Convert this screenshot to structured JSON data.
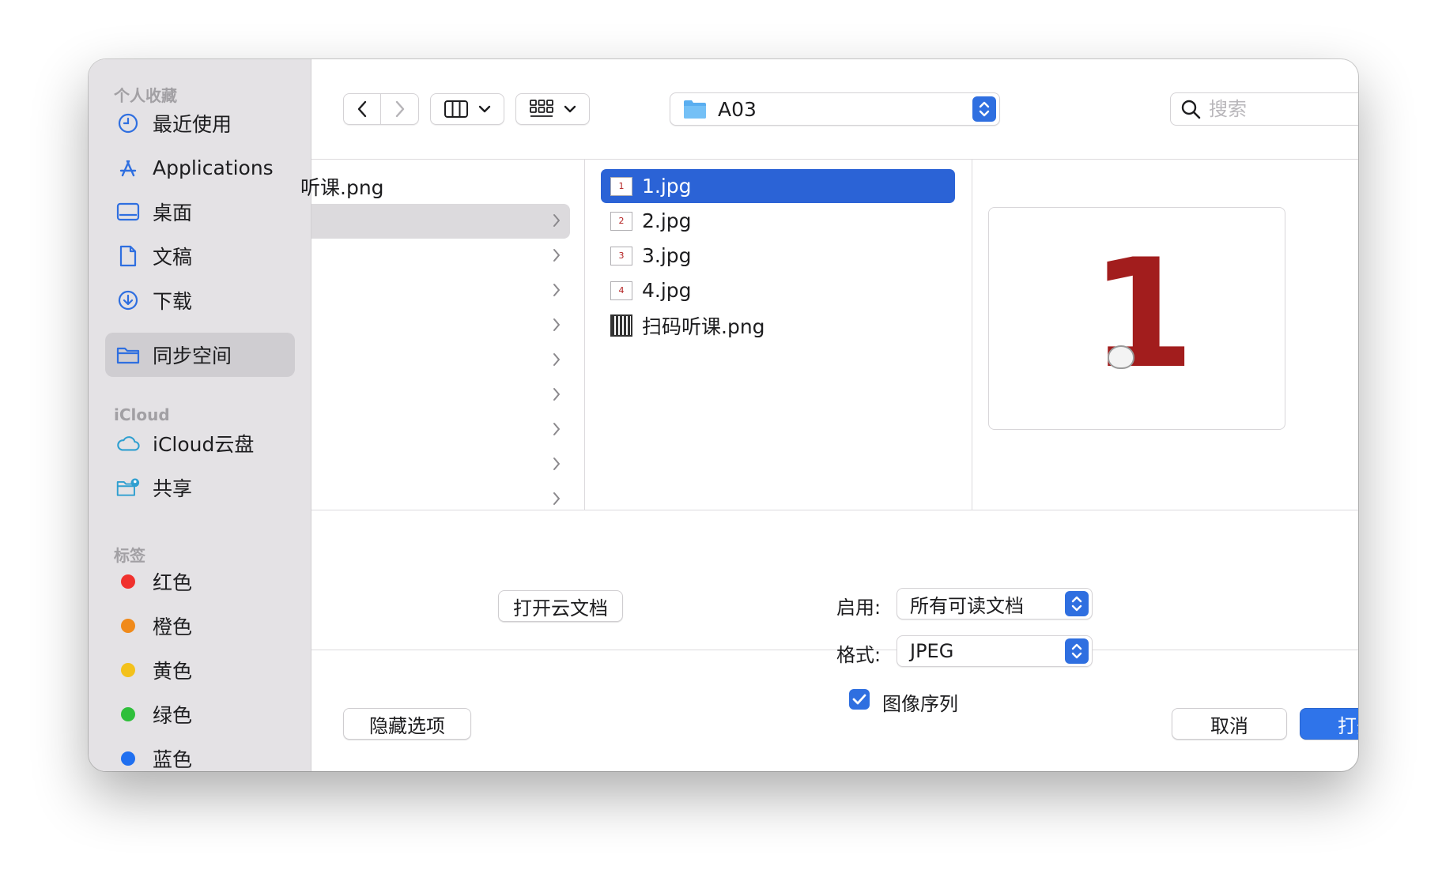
{
  "sidebar": {
    "favorites_title": "个人收藏",
    "favorites": [
      {
        "label": "最近使用",
        "icon": "clock-icon"
      },
      {
        "label": "Applications",
        "icon": "applications-icon"
      },
      {
        "label": "桌面",
        "icon": "desktop-icon"
      },
      {
        "label": "文稿",
        "icon": "document-icon"
      },
      {
        "label": "下载",
        "icon": "download-icon"
      },
      {
        "label": "同步空间",
        "icon": "folder-icon",
        "selected": true
      }
    ],
    "icloud_title": "iCloud",
    "icloud": [
      {
        "label": "iCloud云盘",
        "icon": "cloud-icon"
      },
      {
        "label": "共享",
        "icon": "shared-folder-icon"
      }
    ],
    "tags_title": "标签",
    "tags": [
      {
        "label": "红色",
        "color": "#f0312d"
      },
      {
        "label": "橙色",
        "color": "#f08a1b"
      },
      {
        "label": "黄色",
        "color": "#f3c11b"
      },
      {
        "label": "绿色",
        "color": "#2fbf3b"
      },
      {
        "label": "蓝色",
        "color": "#1f6ff0"
      }
    ]
  },
  "toolbar": {
    "current_folder": "A03",
    "search_placeholder": "搜索"
  },
  "browser": {
    "column1": {
      "partial_item": "听课.png"
    },
    "column2": [
      {
        "name": "1.jpg",
        "thumb": "1",
        "selected": true
      },
      {
        "name": "2.jpg",
        "thumb": "2"
      },
      {
        "name": "3.jpg",
        "thumb": "3"
      },
      {
        "name": "4.jpg",
        "thumb": "4"
      },
      {
        "name": "扫码听课.png",
        "thumb": "qr"
      }
    ],
    "preview_glyph": "1"
  },
  "options": {
    "open_cloud_doc": "打开云文档",
    "enable_label": "启用:",
    "enable_value": "所有可读文档",
    "format_label": "格式:",
    "format_value": "JPEG",
    "image_sequence_label": "图像序列",
    "image_sequence_checked": true
  },
  "footer": {
    "hide_options": "隐藏选项",
    "cancel": "取消",
    "open": "打开"
  },
  "colors": {
    "accent": "#2f6fe0",
    "selection": "#2b63d6"
  }
}
